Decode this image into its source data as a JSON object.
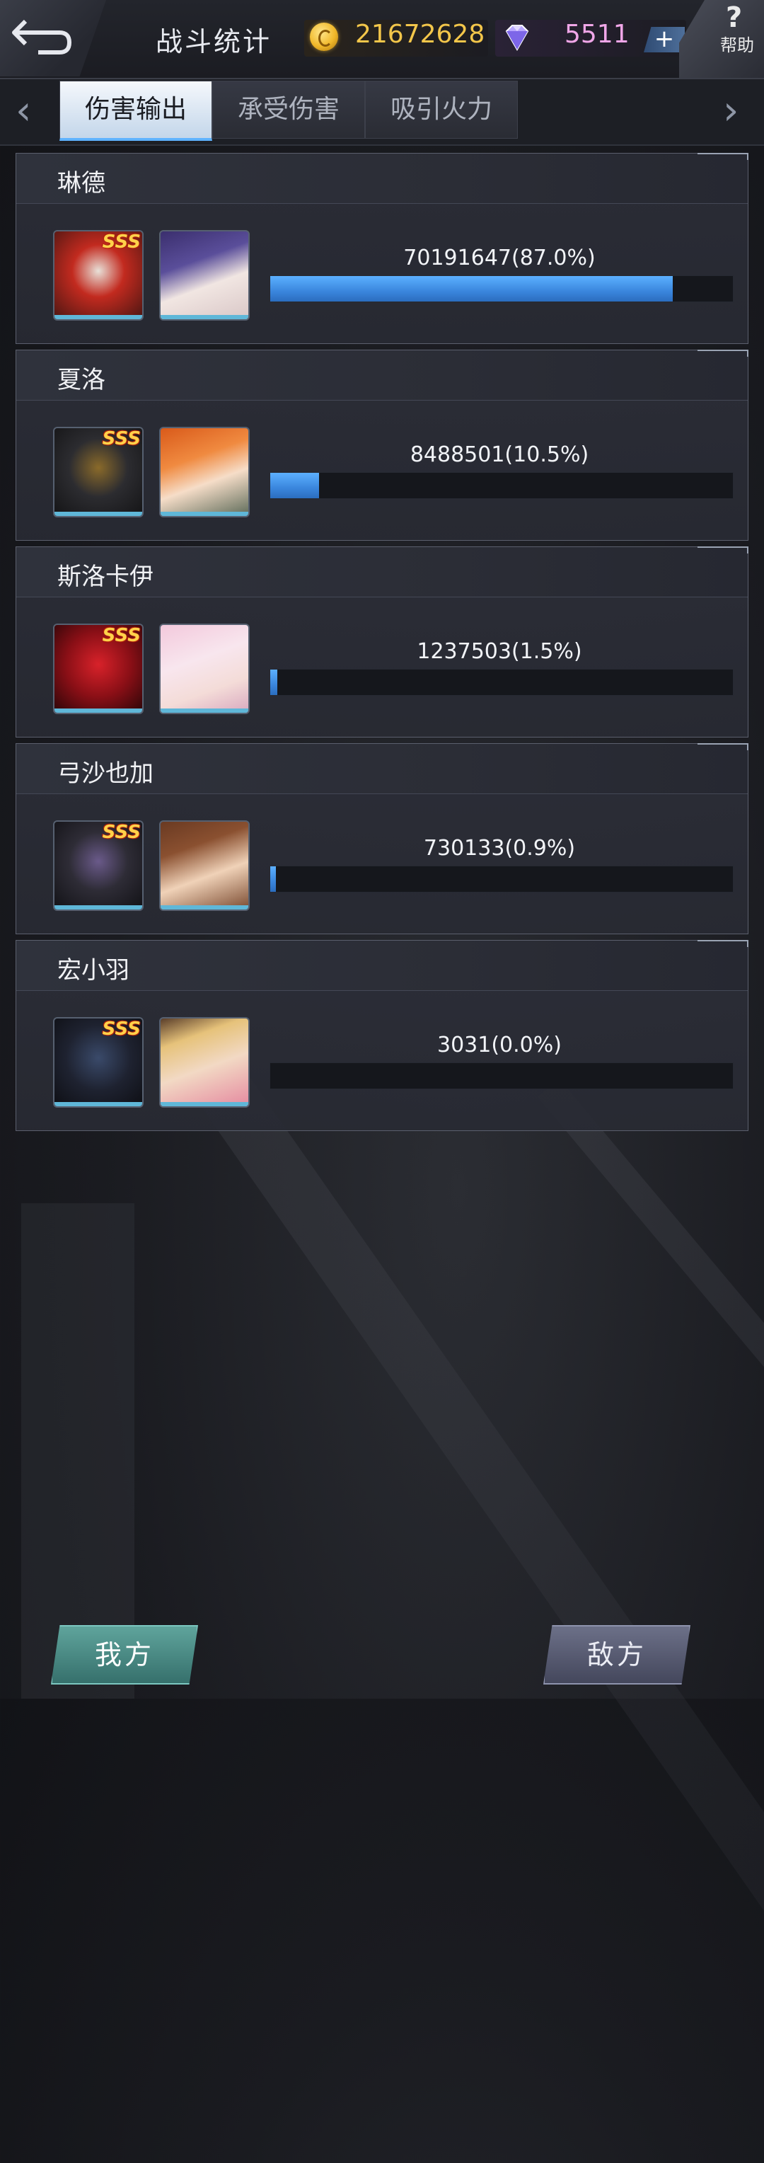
{
  "header": {
    "title": "战斗统计",
    "coins": "21672628",
    "gems": "5511",
    "plus_label": "+",
    "help_symbol": "?",
    "help_label": "帮助"
  },
  "tabs": [
    {
      "label": "伤害输出",
      "active": true
    },
    {
      "label": "承受伤害",
      "active": false
    },
    {
      "label": "吸引火力",
      "active": false
    }
  ],
  "tab_nav": {
    "prev": "‹",
    "next": "›"
  },
  "players": [
    {
      "name": "琳德",
      "damage": "70191647(87.0%)",
      "percent": 87.0,
      "mech_rank": "SSS"
    },
    {
      "name": "夏洛",
      "damage": "8488501(10.5%)",
      "percent": 10.5,
      "mech_rank": "SSS"
    },
    {
      "name": "斯洛卡伊",
      "damage": "1237503(1.5%)",
      "percent": 1.5,
      "mech_rank": "SSS"
    },
    {
      "name": "弓沙也加",
      "damage": "730133(0.9%)",
      "percent": 0.9,
      "mech_rank": "SSS"
    },
    {
      "name": "宏小羽",
      "damage": "3031(0.0%)",
      "percent": 0.0,
      "mech_rank": "SSS"
    }
  ],
  "footer": {
    "our_side": "我方",
    "enemy_side": "敌方"
  },
  "colors": {
    "accent_blue": "#3a86dd",
    "coin_gold": "#f3c64a",
    "gem_pink": "#f0a6e8",
    "our_button": "#4a8a84",
    "enemy_button": "#585b72"
  }
}
